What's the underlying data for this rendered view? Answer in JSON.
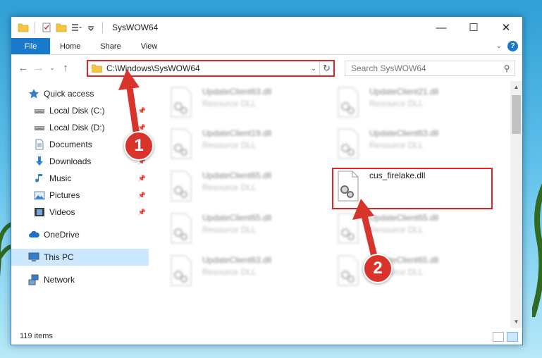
{
  "window": {
    "title": "SysWOW64"
  },
  "ribbon": {
    "tabs": [
      {
        "label": "File"
      },
      {
        "label": "Home"
      },
      {
        "label": "Share"
      },
      {
        "label": "View"
      }
    ],
    "help_label": "?"
  },
  "address": {
    "path": "C:\\Windows\\SysWOW64"
  },
  "search": {
    "placeholder": "Search SysWOW64"
  },
  "sidebar": {
    "items": [
      {
        "label": "Quick access",
        "icon": "star-icon"
      },
      {
        "label": "Local Disk (C:)",
        "icon": "drive-icon",
        "pinned": true
      },
      {
        "label": "Local Disk (D:)",
        "icon": "drive-icon",
        "pinned": true
      },
      {
        "label": "Documents",
        "icon": "documents-icon",
        "pinned": true
      },
      {
        "label": "Downloads",
        "icon": "download-icon",
        "pinned": true
      },
      {
        "label": "Music",
        "icon": "music-icon",
        "pinned": true
      },
      {
        "label": "Pictures",
        "icon": "pictures-icon",
        "pinned": true
      },
      {
        "label": "Videos",
        "icon": "videos-icon",
        "pinned": true
      },
      {
        "label": "OneDrive",
        "icon": "cloud-icon"
      },
      {
        "label": "This PC",
        "icon": "computer-icon",
        "selected": true
      },
      {
        "label": "Network",
        "icon": "network-icon"
      }
    ]
  },
  "files": [
    {
      "name": "UpdateClient63.dll",
      "type": "Resource DLL",
      "blurred": true
    },
    {
      "name": "UpdateClient21.dll",
      "type": "Resource DLL",
      "blurred": true
    },
    {
      "name": "UpdateClient19.dll",
      "type": "Resource DLL",
      "blurred": true
    },
    {
      "name": "UpdateClient63.dll",
      "type": "Resource DLL",
      "blurred": true
    },
    {
      "name": "UpdateClient65.dll",
      "type": "Resource DLL",
      "blurred": true
    },
    {
      "name": "cus_firelake.dll",
      "type": "",
      "blurred": false
    },
    {
      "name": "UpdateClient65.dll",
      "type": "Resource DLL",
      "blurred": true
    },
    {
      "name": "UpdateClient65.dll",
      "type": "Resource DLL",
      "blurred": true
    },
    {
      "name": "UpdateClient63.dll",
      "type": "Resource DLL",
      "blurred": true
    },
    {
      "name": "UpdateClient65.dll",
      "type": "Resource DLL",
      "blurred": true
    }
  ],
  "status": {
    "item_count": "119 items"
  },
  "annotations": {
    "badge1": "1",
    "badge2": "2",
    "color": "#e02424"
  }
}
